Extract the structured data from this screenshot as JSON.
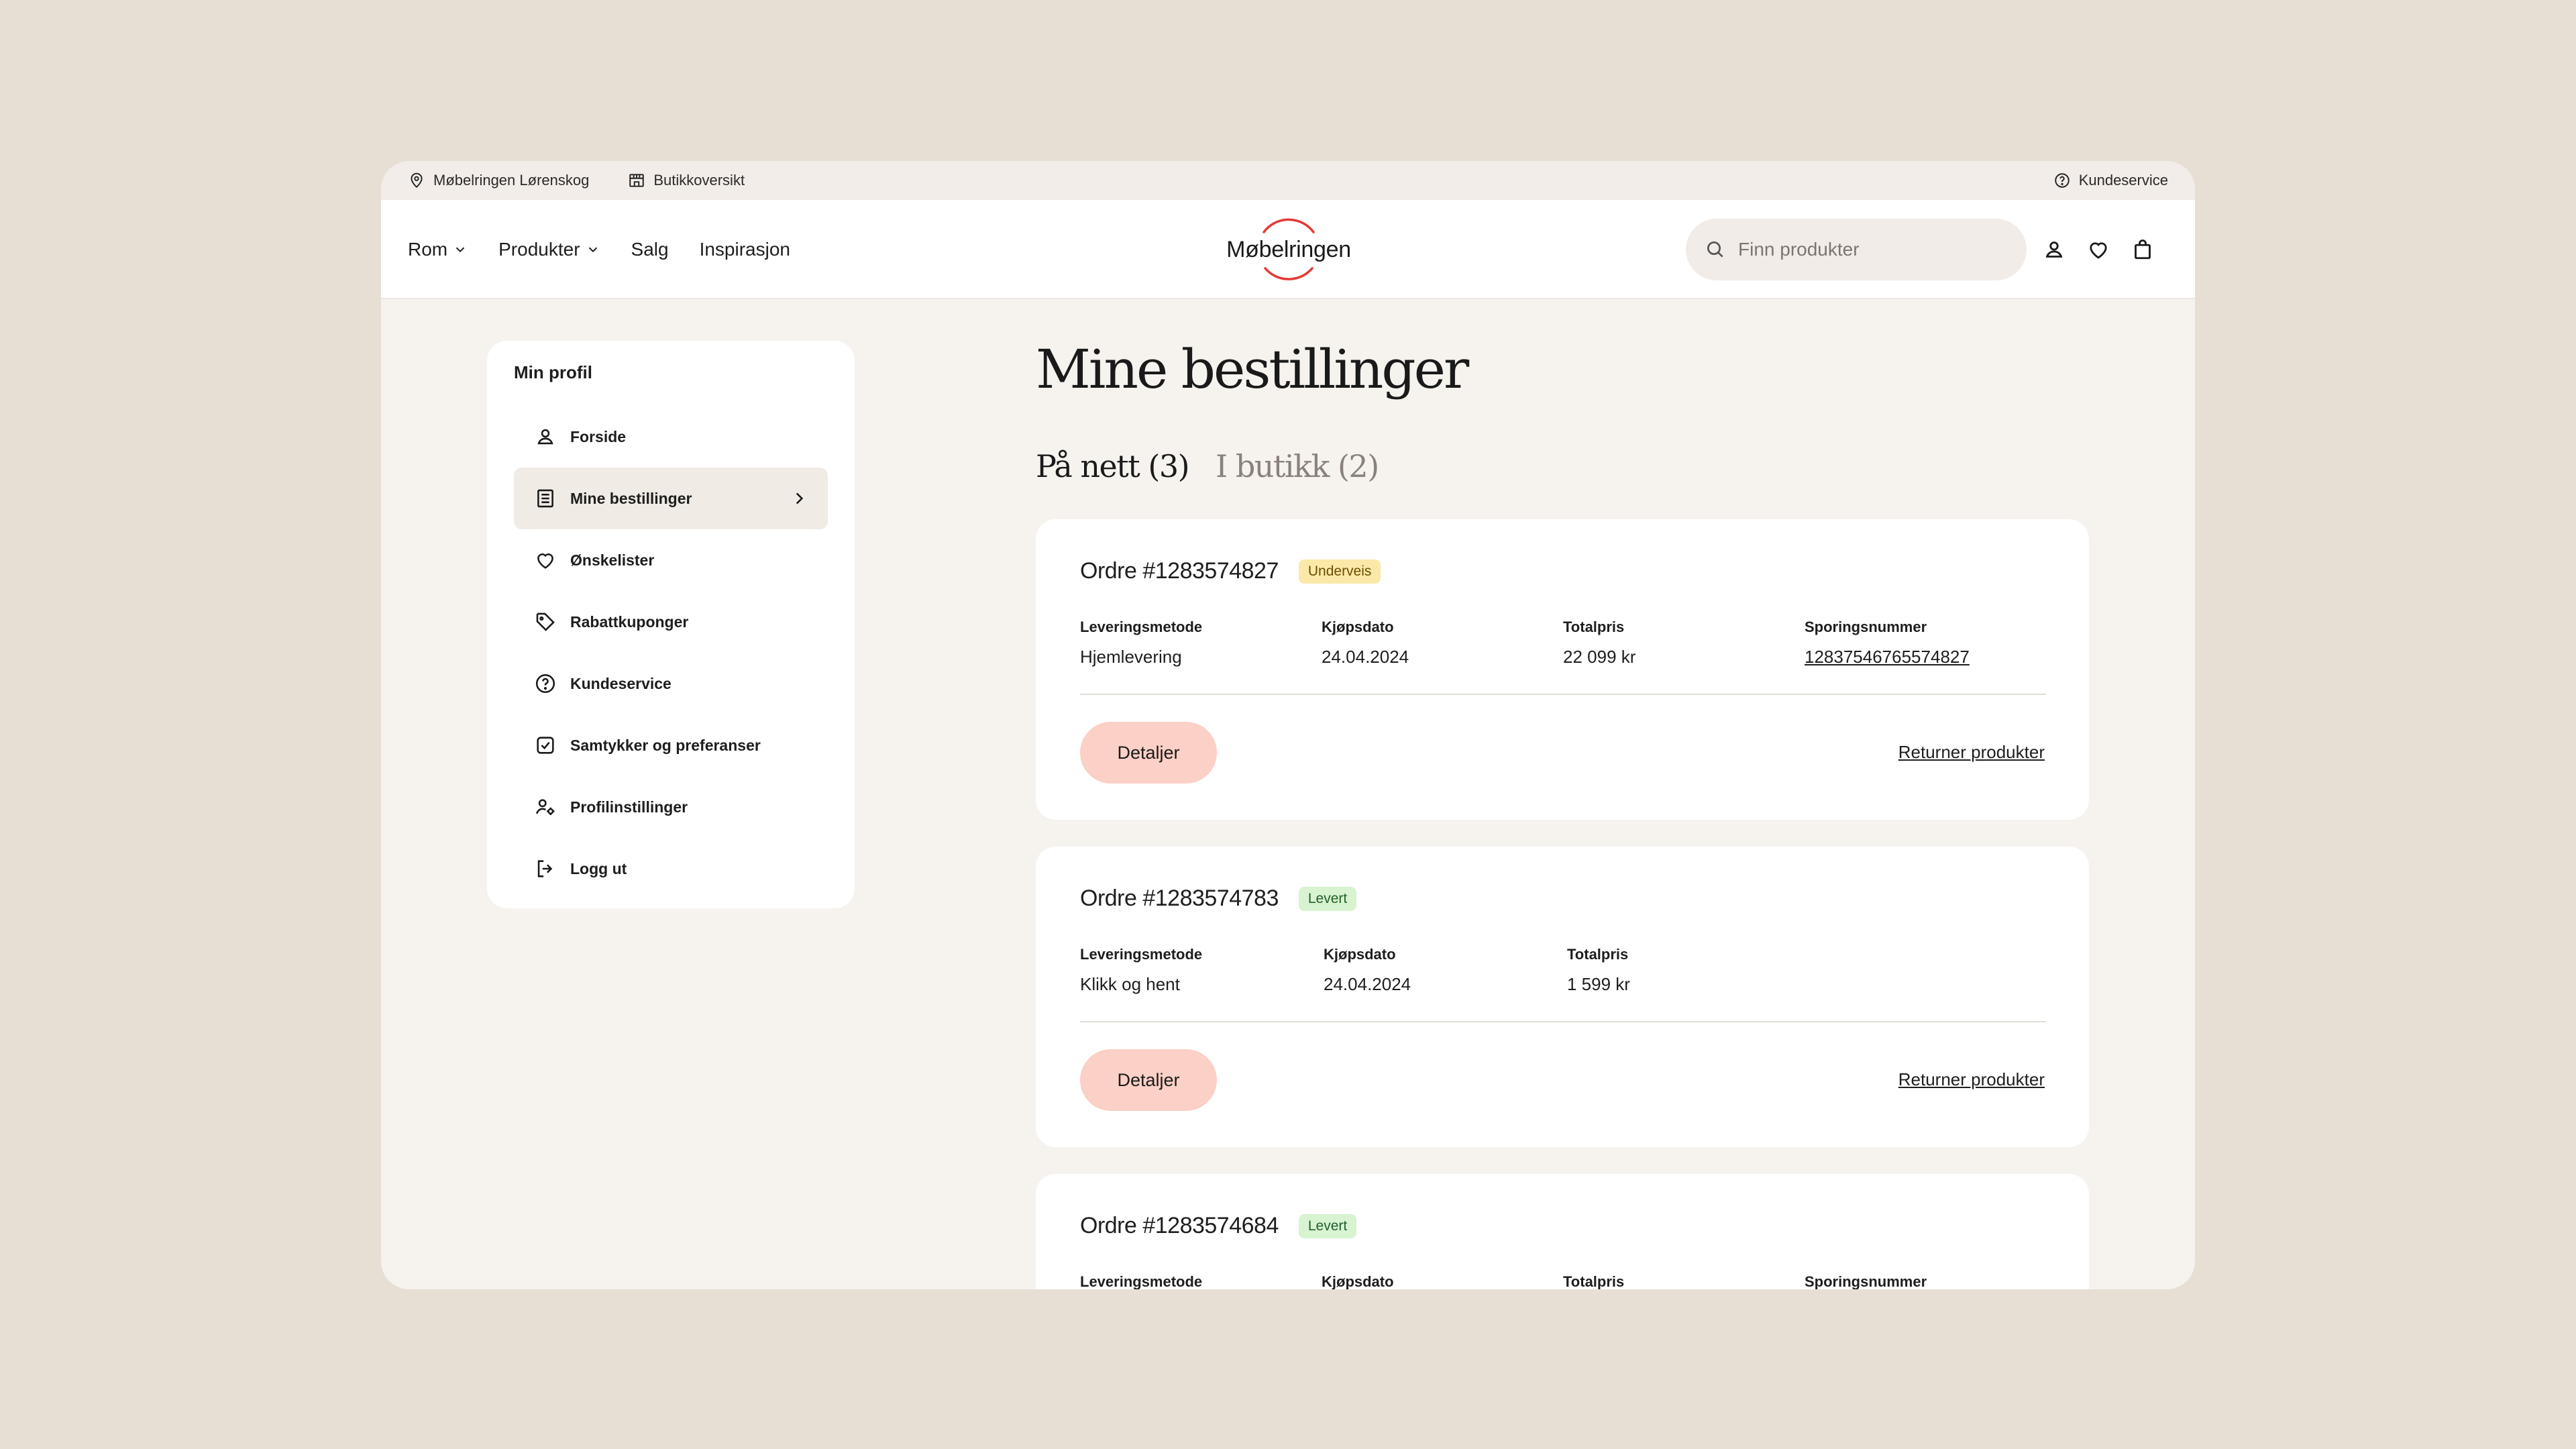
{
  "topbar": {
    "store": "Møbelringen Lørenskog",
    "stores_overview": "Butikkoversikt",
    "customer_service": "Kundeservice"
  },
  "nav": {
    "rooms": "Rom",
    "products": "Produkter",
    "sale": "Salg",
    "inspiration": "Inspirasjon"
  },
  "brand": {
    "logo_text": "Møbelringen",
    "accent": "#e53935"
  },
  "search": {
    "placeholder": "Finn produkter"
  },
  "sidebar": {
    "title": "Min profil",
    "items": [
      {
        "label": "Forside",
        "icon": "user-icon"
      },
      {
        "label": "Mine bestillinger",
        "icon": "orders-list-icon",
        "active": true
      },
      {
        "label": "Ønskelister",
        "icon": "heart-icon"
      },
      {
        "label": "Rabattkuponger",
        "icon": "tag-icon"
      },
      {
        "label": "Kundeservice",
        "icon": "help-icon"
      },
      {
        "label": "Samtykker og preferanser",
        "icon": "checkbox-icon"
      },
      {
        "label": "Profilinstillinger",
        "icon": "user-settings-icon"
      },
      {
        "label": "Logg ut",
        "icon": "logout-icon"
      }
    ]
  },
  "main": {
    "title": "Mine bestillinger",
    "tabs": [
      {
        "label": "På nett (3)",
        "active": true
      },
      {
        "label": "I butikk (2)",
        "active": false
      }
    ],
    "labels": {
      "delivery_method": "Leveringsmetode",
      "purchase_date": "Kjøpsdato",
      "total_price": "Totalpris",
      "tracking_number": "Sporingsnummer",
      "details_button": "Detaljer",
      "return_link": "Returner produkter"
    },
    "orders": [
      {
        "id": "Ordre #1283574827",
        "status": "Underveis",
        "delivery_method": "Hjemlevering",
        "purchase_date": "24.04.2024",
        "total_price": "22 099 kr",
        "tracking_number": "12837546765574827"
      },
      {
        "id": "Ordre #1283574783",
        "status": "Levert",
        "delivery_method": "Klikk og hent",
        "purchase_date": "24.04.2024",
        "total_price": "1 599 kr"
      },
      {
        "id": "Ordre #1283574684",
        "status": "Levert"
      }
    ]
  }
}
